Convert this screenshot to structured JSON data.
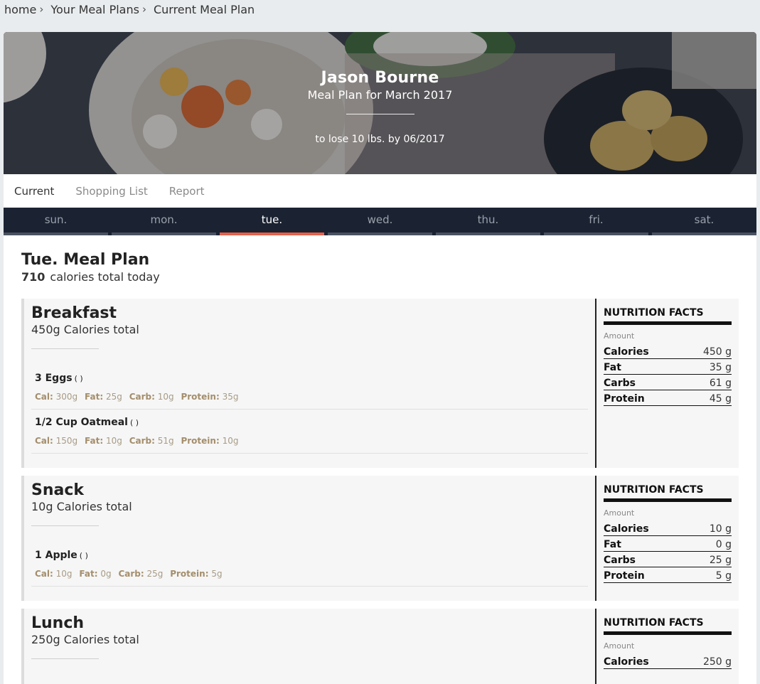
{
  "breadcrumb": {
    "home": "home",
    "plans": "Your Meal Plans",
    "current": "Current Meal Plan"
  },
  "hero": {
    "name": "Jason Bourne",
    "subtitle": "Meal Plan for March 2017",
    "goal": "to lose 10 lbs. by 06/2017"
  },
  "tabs": {
    "current": "Current",
    "shopping": "Shopping List",
    "report": "Report"
  },
  "days": [
    "sun.",
    "mon.",
    "tue.",
    "wed.",
    "thu.",
    "fri.",
    "sat."
  ],
  "active_day": "tue.",
  "colors": {
    "accent": "#e8604c",
    "dark_nav": "#1b2333",
    "macro_label": "#a48e6c"
  },
  "plan": {
    "title": "Tue. Meal Plan",
    "calories": "710",
    "calories_label": "calories total today"
  },
  "nutrition_labels": {
    "title": "NUTRITION FACTS",
    "amount": "Amount",
    "calories": "Calories",
    "fat": "Fat",
    "carbs": "Carbs",
    "protein": "Protein"
  },
  "macro_labels": {
    "cal": "Cal:",
    "fat": "Fat:",
    "carb": "Carb:",
    "protein": "Protein:"
  },
  "meals": [
    {
      "name": "Breakfast",
      "total": "450g Calories total",
      "items": [
        {
          "name": "3 Eggs",
          "paren": "( )",
          "cal": "300g",
          "fat": "25g",
          "carb": "10g",
          "protein": "35g"
        },
        {
          "name": "1/2 Cup Oatmeal",
          "paren": "( )",
          "cal": "150g",
          "fat": "10g",
          "carb": "51g",
          "protein": "10g"
        }
      ],
      "nutrition": {
        "calories": "450 g",
        "fat": "35 g",
        "carbs": "61 g",
        "protein": "45 g"
      }
    },
    {
      "name": "Snack",
      "total": "10g Calories total",
      "items": [
        {
          "name": "1 Apple",
          "paren": "( )",
          "cal": "10g",
          "fat": "0g",
          "carb": "25g",
          "protein": "5g"
        }
      ],
      "nutrition": {
        "calories": "10 g",
        "fat": "0 g",
        "carbs": "25 g",
        "protein": "5 g"
      }
    },
    {
      "name": "Lunch",
      "total": "250g Calories total",
      "items": [],
      "nutrition": {
        "calories": "250 g",
        "fat": "",
        "carbs": "",
        "protein": ""
      }
    }
  ]
}
